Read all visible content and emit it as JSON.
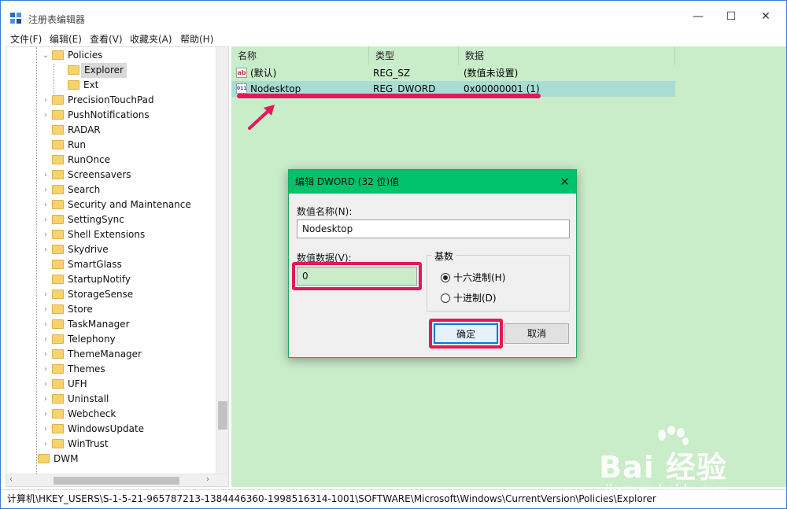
{
  "window": {
    "title": "注册表编辑器",
    "minimize_glyph": "—",
    "maximize_glyph": "☐",
    "close_glyph": "✕"
  },
  "menu": [
    "文件(F)",
    "编辑(E)",
    "查看(V)",
    "收藏夹(A)",
    "帮助(H)"
  ],
  "tree": {
    "items": [
      {
        "label": "Policies",
        "expanded": true
      },
      {
        "label": "Explorer",
        "selected": true
      },
      {
        "label": "Ext"
      },
      {
        "label": "PrecisionTouchPad"
      },
      {
        "label": "PushNotifications"
      },
      {
        "label": "RADAR"
      },
      {
        "label": "Run"
      },
      {
        "label": "RunOnce"
      },
      {
        "label": "Screensavers"
      },
      {
        "label": "Search"
      },
      {
        "label": "Security and Maintenance"
      },
      {
        "label": "SettingSync"
      },
      {
        "label": "Shell Extensions"
      },
      {
        "label": "Skydrive"
      },
      {
        "label": "SmartGlass"
      },
      {
        "label": "StartupNotify"
      },
      {
        "label": "StorageSense"
      },
      {
        "label": "Store"
      },
      {
        "label": "TaskManager"
      },
      {
        "label": "Telephony"
      },
      {
        "label": "ThemeManager"
      },
      {
        "label": "Themes"
      },
      {
        "label": "UFH"
      },
      {
        "label": "Uninstall"
      },
      {
        "label": "Webcheck"
      },
      {
        "label": "WindowsUpdate"
      },
      {
        "label": "WinTrust"
      },
      {
        "label": "DWM"
      }
    ]
  },
  "values": {
    "columns": [
      "名称",
      "类型",
      "数据"
    ],
    "rows": [
      {
        "name": "(默认)",
        "type": "REG_SZ",
        "data": "(数值未设置)",
        "icon": "string-value-icon",
        "icon_text": "ab"
      },
      {
        "name": "Nodesktop",
        "type": "REG_DWORD",
        "data": "0x00000001 (1)",
        "icon": "dword-value-icon",
        "icon_text": "011",
        "selected": true
      }
    ]
  },
  "status_path": "计算机\\HKEY_USERS\\S-1-5-21-965787213-1384446360-1998516314-1001\\SOFTWARE\\Microsoft\\Windows\\CurrentVersion\\Policies\\Explorer",
  "dialog": {
    "title": "编辑 DWORD (32 位)值",
    "close_glyph": "✕",
    "name_label": "数值名称(N):",
    "name_value": "Nodesktop",
    "data_label": "数值数据(V):",
    "data_value": "0",
    "base_label": "基数",
    "hex_label": "十六进制(H)",
    "dec_label": "十进制(D)",
    "selected_base": "hex",
    "ok_label": "确定",
    "cancel_label": "取消"
  },
  "watermark": {
    "brand": "Bai 经验",
    "url": "jingyan.baidu.com"
  },
  "colors": {
    "values_bg": "#c9ecc9",
    "dialog_title_bg": "#00c26a",
    "annotation": "#e0195a"
  }
}
